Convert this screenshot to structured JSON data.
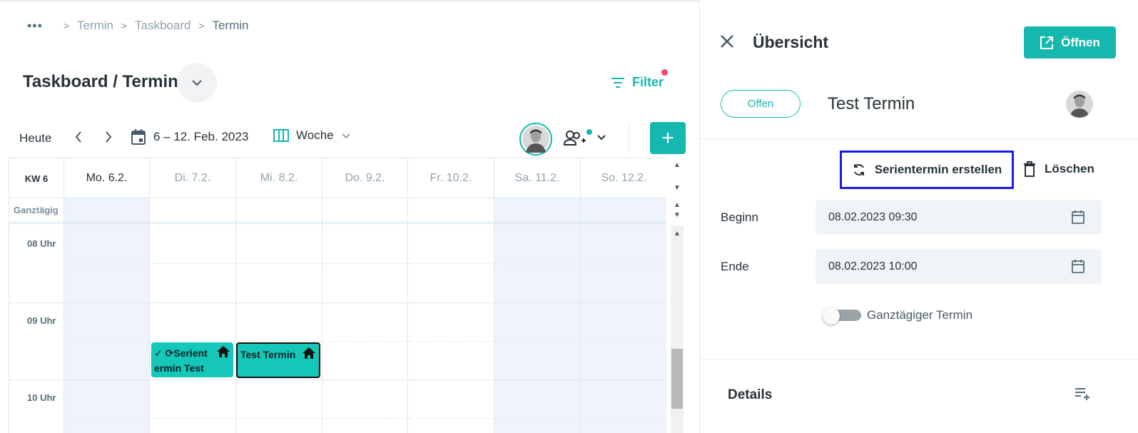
{
  "breadcrumb": {
    "more": "•••",
    "items": [
      "Termin",
      "Taskboard",
      "Termin"
    ]
  },
  "page_title": "Taskboard / Termin",
  "filter_label": "Filter",
  "toolbar": {
    "today_label": "Heute",
    "range_label": "6 – 12. Feb. 2023",
    "view_label": "Woche"
  },
  "calendar": {
    "week_label": "KW 6",
    "days": [
      "Mo. 6.2.",
      "Di. 7.2.",
      "Mi. 8.2.",
      "Do. 9.2.",
      "Fr. 10.2.",
      "Sa. 11.2.",
      "So. 12.2."
    ],
    "allday_label": "Ganztägig",
    "hours": [
      "08 Uhr",
      "09 Uhr",
      "10 Uhr"
    ],
    "events": [
      {
        "title_line1": "✓ ⟳Serient",
        "title_line2": "ermin Test",
        "day": "Di. 7.2."
      },
      {
        "title": "Test Termin",
        "day": "Mi. 8.2."
      }
    ]
  },
  "panel": {
    "title": "Übersicht",
    "open_label": "Öffnen",
    "status": "Offen",
    "event_name": "Test Termin",
    "series_label": "Serientermin erstellen",
    "delete_label": "Löschen",
    "begin_label": "Beginn",
    "begin_value": "08.02.2023 09:30",
    "end_label": "Ende",
    "end_value": "08.02.2023 10:00",
    "allday_toggle_label": "Ganztägiger Termin",
    "allday_toggle_on": false,
    "details_label": "Details"
  },
  "colors": {
    "accent": "#14b8ae",
    "event": "#14c7b8",
    "highlight_border": "#1a1ae6",
    "notification_dot": "#ef4a6a"
  }
}
